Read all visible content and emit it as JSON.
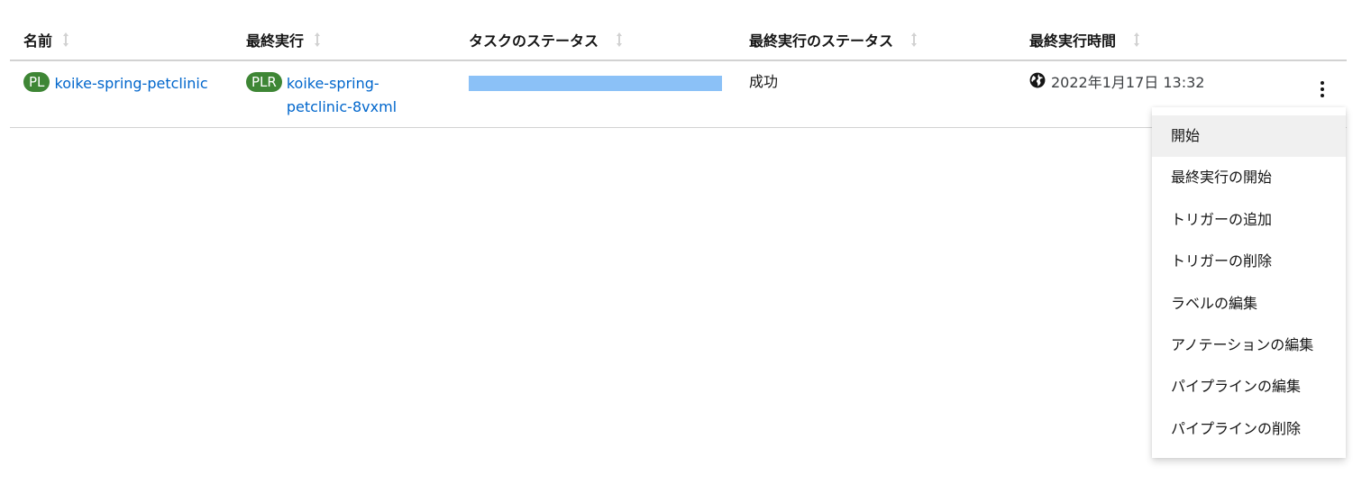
{
  "table": {
    "headers": [
      {
        "label": "名前"
      },
      {
        "label": "最終実行"
      },
      {
        "label": "タスクのステータス"
      },
      {
        "label": "最終実行のステータス"
      },
      {
        "label": "最終実行時間"
      }
    ],
    "rows": [
      {
        "name_badge": "PL",
        "name": "koike-spring-petclinic",
        "last_run_badge": "PLR",
        "last_run": "koike-spring-petclinic-8vxml",
        "task_status_progress": 1.0,
        "last_run_status": "成功",
        "last_run_time": "2022年1月17日 13:32"
      }
    ]
  },
  "kebab_menu": {
    "items": [
      {
        "label": "開始",
        "active": true
      },
      {
        "label": "最終実行の開始"
      },
      {
        "label": "トリガーの追加"
      },
      {
        "label": "トリガーの削除"
      },
      {
        "label": "ラベルの編集"
      },
      {
        "label": "アノテーションの編集"
      },
      {
        "label": "パイプラインの編集"
      },
      {
        "label": "パイプラインの削除"
      }
    ]
  },
  "colors": {
    "badge": "#3e8635",
    "link": "#0066cc",
    "progress_fill": "#8bc1f7",
    "menu_active_bg": "#f0f0f0"
  },
  "icons": {
    "sort": "sort-icon",
    "globe": "globe-icon",
    "kebab": "kebab-icon"
  }
}
